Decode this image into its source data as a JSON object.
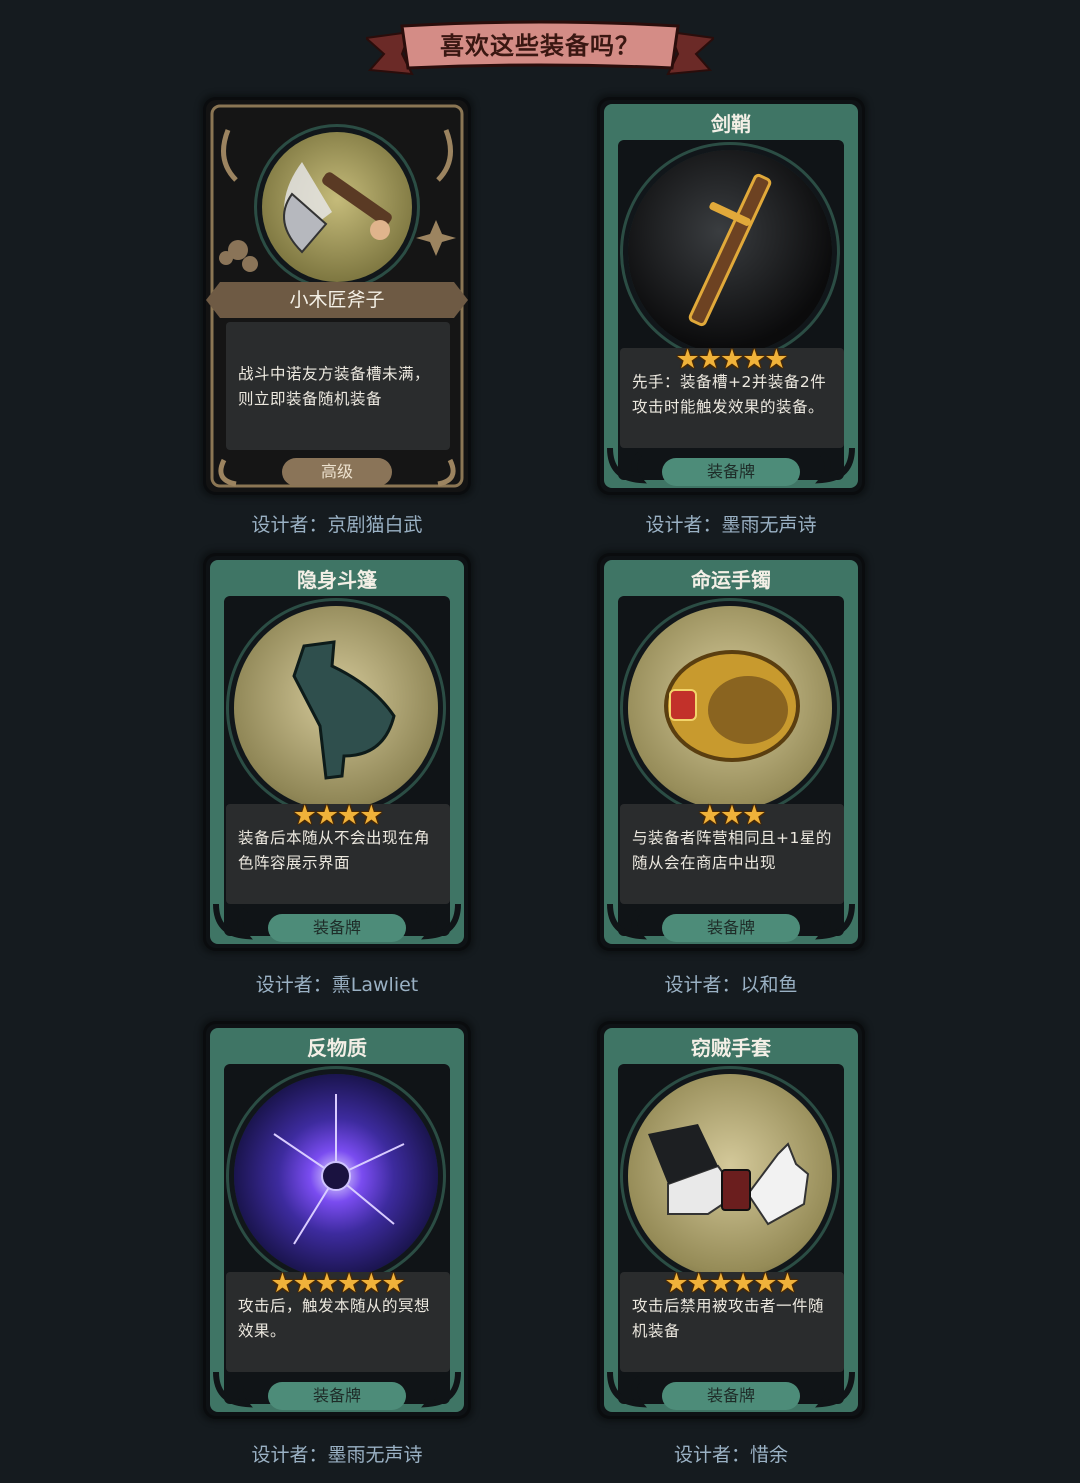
{
  "page": {
    "title": "喜欢这些装备吗？"
  },
  "cards": [
    {
      "name": "小木匠斧子",
      "stars": "",
      "description": "战斗中诺友方装备槽未满，则立即装备随机装备",
      "tag": "高级",
      "designer": "设计者：京剧猫白武",
      "style": "gold"
    },
    {
      "name": "剑鞘",
      "stars": "★★★★★",
      "description": "先手：装备槽+2并装备2件攻击时能触发效果的装备。",
      "tag": "装备牌",
      "designer": "设计者：墨雨无声诗",
      "style": "green"
    },
    {
      "name": "隐身斗篷",
      "stars": "★★★★",
      "description": "装备后本随从不会出现在角色阵容展示界面",
      "tag": "装备牌",
      "designer": "设计者：熏Lawliet",
      "style": "green"
    },
    {
      "name": "命运手镯",
      "stars": "★★★",
      "description": "与装备者阵营相同且+1星的随从会在商店中出现",
      "tag": "装备牌",
      "designer": "设计者：以和鱼",
      "style": "green"
    },
    {
      "name": "反物质",
      "stars": "★★★★★★",
      "description": "攻击后，触发本随从的冥想效果。",
      "tag": "装备牌",
      "designer": "设计者：墨雨无声诗",
      "style": "green"
    },
    {
      "name": "窃贼手套",
      "stars": "★★★★★★",
      "description": "攻击后禁用被攻击者一件随机装备",
      "tag": "装备牌",
      "designer": "设计者：惜余",
      "style": "green"
    }
  ],
  "colors": {
    "background": "#151b1f",
    "frame_green": "#3f7565",
    "star": "#f0b23a",
    "designer_text": "#9ab1c4"
  },
  "icons": [
    "axe-icon",
    "sword-sheath-icon",
    "cloak-icon",
    "bracelet-icon",
    "antimatter-icon",
    "glove-icon"
  ]
}
